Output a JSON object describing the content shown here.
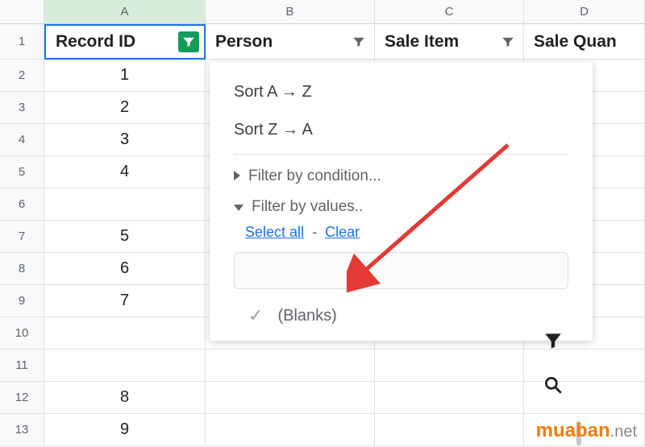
{
  "columns": {
    "a": "A",
    "b": "B",
    "c": "C",
    "d": "D"
  },
  "headers": {
    "record_id": "Record ID",
    "person": "Person",
    "sale_item": "Sale Item",
    "sale_quan": "Sale Quan"
  },
  "rows": [
    {
      "num": "1",
      "a": ""
    },
    {
      "num": "2",
      "a": "1"
    },
    {
      "num": "3",
      "a": "2"
    },
    {
      "num": "4",
      "a": "3"
    },
    {
      "num": "5",
      "a": "4"
    },
    {
      "num": "6",
      "a": ""
    },
    {
      "num": "7",
      "a": "5"
    },
    {
      "num": "8",
      "a": "6"
    },
    {
      "num": "9",
      "a": "7"
    },
    {
      "num": "10",
      "a": ""
    },
    {
      "num": "11",
      "a": ""
    },
    {
      "num": "12",
      "a": "8"
    },
    {
      "num": "13",
      "a": "9"
    }
  ],
  "dropdown": {
    "sort_az": "Sort A → Z",
    "sort_za": "Sort Z → A",
    "filter_condition": "Filter by condition...",
    "filter_values": "Filter by values..",
    "select_all": "Select all",
    "clear": "Clear",
    "blanks": "(Blanks)"
  },
  "watermark": {
    "brand": "muaban",
    "suffix": ".net"
  }
}
